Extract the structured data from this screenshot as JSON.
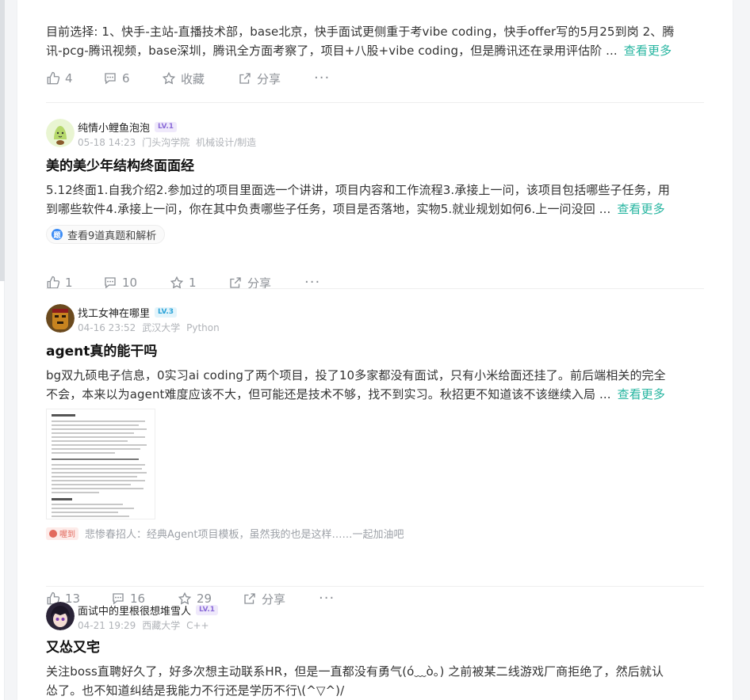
{
  "posts": [
    {
      "content_lines": [
        "目前选择: 1、快手-主站-直播技术部，base北京，快手面试更侧重于考vibe coding，快手offer写的5月25到岗 2、腾",
        "讯-pcg-腾讯视频，base深圳，腾讯全方面考察了，项目+八股+vibe coding，但是腾讯还在录用评估阶 ..."
      ],
      "more": "查看更多",
      "likes": "4",
      "comments": "6",
      "fav": "收藏",
      "share": "分享"
    },
    {
      "user": "纯情小鲤鱼泡泡",
      "level": "LV.1",
      "date": "05-18 14:23",
      "school": "门头沟学院",
      "major": "机械设计/制造",
      "title": "美的美少年结构终面面经",
      "content_lines": [
        "5.12终面1.自我介绍2.参加过的项目里面选一个讲讲，项目内容和工作流程3.承接上一问，该项目包括哪些子任务，用",
        "到哪些软件4.承接上一问，你在其中负责哪些子任务，项目是否落地，实物5.就业规划如何6.上一问没回 ..."
      ],
      "more": "查看更多",
      "chip": "查看9道真题和解析",
      "likes": "1",
      "comments": "10",
      "fav": "1",
      "share": "分享"
    },
    {
      "user": "找工女神在哪里",
      "level": "LV.3",
      "date": "04-16 23:52",
      "school": "武汉大学",
      "major": "Python",
      "title": "agent真的能干吗",
      "content_lines": [
        "bg双九硕电子信息，0实习ai coding了两个项目，投了10多家都没有面试，只有小米给面还挂了。前后端相关的完全",
        "不会，本来以为agent难度应该不大，但可能还是技术不够，找不到实习。秋招更不知道该不该继续入局 ..."
      ],
      "more": "查看更多",
      "comment_tag": "喔到",
      "comment_text": "悲惨春招人：经典Agent项目模板，虽然我的也是这样……一起加油吧",
      "likes": "13",
      "comments": "16",
      "fav": "29",
      "share": "分享"
    },
    {
      "user": "面试中的里根很想堆雪人",
      "level": "LV.1",
      "date": "04-21 19:29",
      "school": "西藏大学",
      "major": "C++",
      "title": "又怂又宅",
      "content_lines": [
        "关注boss直聘好久了，好多次想主动联系HR，但是一直都没有勇气(ó﹏ò｡) 之前被某二线游戏厂商拒绝了，然后就认",
        "怂了。也不知道纠结是我能力不行还是学历不行\\(^▽^)/"
      ]
    }
  ],
  "colors": {
    "accent": "#26b5a0",
    "lv1": "#8b6cd8",
    "lv3": "#2aa3d8"
  }
}
